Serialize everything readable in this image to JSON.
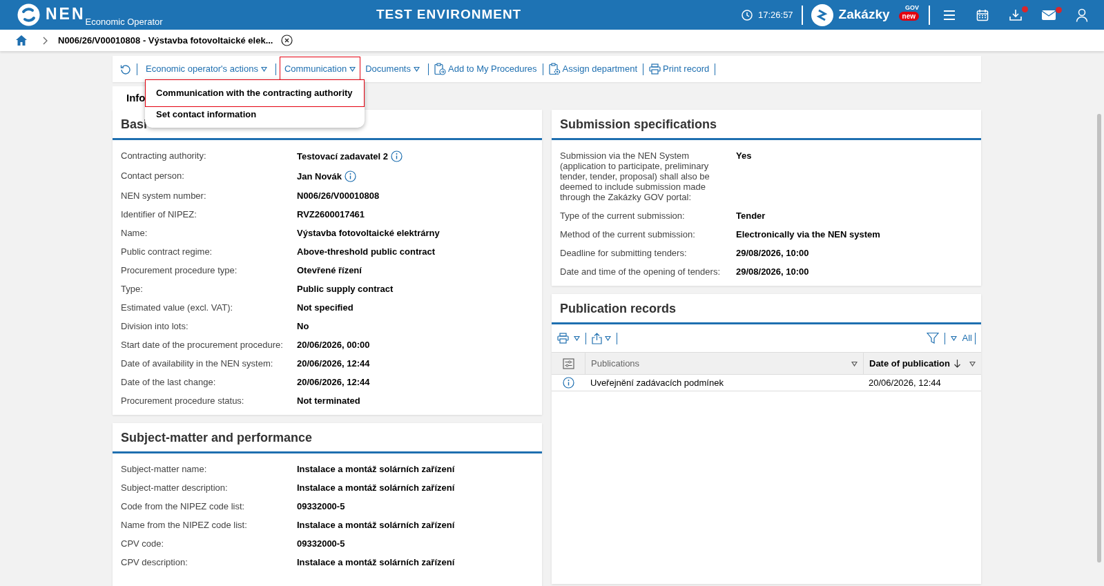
{
  "header": {
    "brand": "NEN",
    "subtitle": "Economic Operator",
    "environment": "TEST ENVIRONMENT",
    "time": "17:26:57",
    "portal": "Zakázky",
    "portal_sup": "GOV",
    "portal_badge": "new",
    "icons": [
      {
        "kind": "menu",
        "notification": false
      },
      {
        "kind": "calendar",
        "notification": false
      },
      {
        "kind": "download",
        "notification": true
      },
      {
        "kind": "mail",
        "notification": true
      },
      {
        "kind": "user",
        "notification": false
      }
    ]
  },
  "breadcrumb": {
    "title": "N006/26/V00010808 - Výstavba fotovoltaické elek..."
  },
  "toolbar": [
    {
      "kind": "refresh"
    },
    {
      "kind": "dropdown",
      "label": "Economic operator's actions",
      "selected": false
    },
    {
      "kind": "dropdown",
      "label": "Communication",
      "selected": true
    },
    {
      "kind": "dropdown",
      "label": "Documents",
      "selected": false
    },
    {
      "kind": "add",
      "label": "Add to My Procedures"
    },
    {
      "kind": "assign",
      "label": "Assign department"
    },
    {
      "kind": "print",
      "label": "Print record"
    }
  ],
  "menu": [
    {
      "label": "Communication with the contracting authority",
      "selected": true
    },
    {
      "label": "Set contact information",
      "selected": false
    }
  ],
  "tab": {
    "label": "Info",
    "selected": true
  },
  "basic": {
    "title": "Basi",
    "rows": [
      {
        "label": "Contracting authority:",
        "value": "Testovací zadavatel 2",
        "info": true
      },
      {
        "label": "Contact person:",
        "value": "Jan Novák",
        "info": true
      },
      {
        "label": "NEN system number:",
        "value": "N006/26/V00010808",
        "info": false
      },
      {
        "label": "Identifier of NIPEZ:",
        "value": "RVZ2600017461",
        "info": false
      },
      {
        "label": "Name:",
        "value": "Výstavba fotovoltaické elektrárny",
        "info": false
      },
      {
        "label": "Public contract regime:",
        "value": "Above-threshold public contract",
        "info": false
      },
      {
        "label": "Procurement procedure type:",
        "value": "Otevřené řízení",
        "info": false
      },
      {
        "label": "Type:",
        "value": "Public supply contract",
        "info": false
      },
      {
        "label": "Estimated value (excl. VAT):",
        "value": "Not specified",
        "info": false
      },
      {
        "label": "Division into lots:",
        "value": "No",
        "info": false
      },
      {
        "label": "Start date of the procurement procedure:",
        "value": "20/06/2026, 00:00",
        "info": false
      },
      {
        "label": "Date of availability in the NEN system:",
        "value": "20/06/2026, 12:44",
        "info": false
      },
      {
        "label": "Date of the last change:",
        "value": "20/06/2026, 12:44",
        "info": false
      },
      {
        "label": "Procurement procedure status:",
        "value": "Not terminated",
        "info": false
      }
    ]
  },
  "subject": {
    "title": "Subject-matter and performance",
    "rows": [
      {
        "label": "Subject-matter name:",
        "value": "Instalace a montáž solárních zařízení",
        "info": false
      },
      {
        "label": "Subject-matter description:",
        "value": "Instalace a montáž solárních zařízení",
        "info": false
      },
      {
        "label": "Code from the NIPEZ code list:",
        "value": "09332000-5",
        "info": false
      },
      {
        "label": "Name from the NIPEZ code list:",
        "value": "Instalace a montáž solárních zařízení",
        "info": false
      },
      {
        "label": "CPV code:",
        "value": "09332000-5",
        "info": false
      },
      {
        "label": "CPV description:",
        "value": "Instalace a montáž solárních zařízení",
        "info": false
      }
    ]
  },
  "submission": {
    "title": "Submission specifications",
    "rows": [
      {
        "label": "Submission via the NEN System (application to participate, preliminary tender, tender, proposal) shall also be deemed to include submission made through the Zakázky GOV portal:",
        "value": "Yes",
        "info": false
      },
      {
        "label": "Type of the current submission:",
        "value": "Tender",
        "info": false
      },
      {
        "label": "Method of the current submission:",
        "value": "Electronically via the NEN system",
        "info": false
      },
      {
        "label": "Deadline for submitting tenders:",
        "value": "29/08/2026, 10:00",
        "info": false
      },
      {
        "label": "Date and time of the opening of tenders:",
        "value": "29/08/2026, 10:00",
        "info": false
      }
    ]
  },
  "publication": {
    "title": "Publication records",
    "filter_label": "All",
    "columns": [
      {
        "label": "Publications",
        "sorted": false
      },
      {
        "label": "Date of publication",
        "sorted": true
      }
    ],
    "rows": [
      {
        "publication": "Uveřejnění zadávacích podmínek",
        "date": "20/06/2026, 12:44"
      }
    ]
  }
}
